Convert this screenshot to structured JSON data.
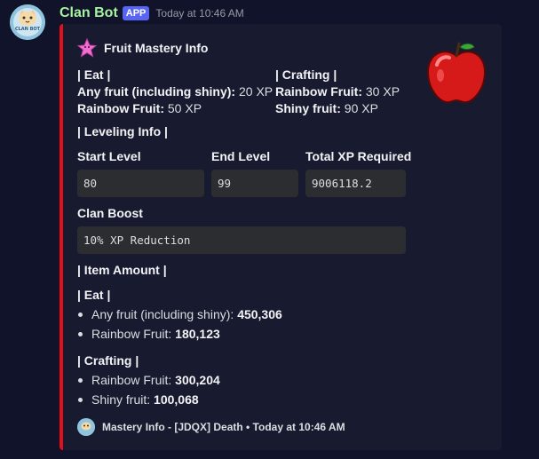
{
  "message": {
    "username": "Clan Bot",
    "badge": "APP",
    "timestamp": "Today at 10:46 AM",
    "avatar_text": "CLAN BOT"
  },
  "embed": {
    "accent_color": "#e1101a",
    "author": "Fruit Mastery Info",
    "thumbnail": "red-apple-icon",
    "eat": {
      "title": "| Eat |",
      "lines": [
        {
          "label": "Any fruit (including shiny):",
          "value": "20 XP"
        },
        {
          "label": "Rainbow Fruit:",
          "value": "50 XP"
        }
      ]
    },
    "crafting": {
      "title": "| Crafting |",
      "lines": [
        {
          "label": "Rainbow Fruit:",
          "value": "30 XP"
        },
        {
          "label": "Shiny fruit:",
          "value": "90 XP"
        }
      ]
    },
    "leveling_title": "| Leveling Info |",
    "start_level": {
      "label": "Start Level",
      "value": "80"
    },
    "end_level": {
      "label": "End Level",
      "value": "99"
    },
    "total_xp": {
      "label": "Total XP Required",
      "value": "9006118.2"
    },
    "clan_boost": {
      "label": "Clan Boost",
      "value": "10% XP Reduction"
    },
    "item_amount_title": "| Item Amount |",
    "items_eat": {
      "title": "| Eat |",
      "items": [
        {
          "label": "Any fruit (including shiny):",
          "value": "450,306"
        },
        {
          "label": "Rainbow Fruit:",
          "value": "180,123"
        }
      ]
    },
    "items_crafting": {
      "title": "| Crafting |",
      "items": [
        {
          "label": "Rainbow Fruit:",
          "value": "300,204"
        },
        {
          "label": "Shiny fruit:",
          "value": "100,068"
        }
      ]
    },
    "footer": "Mastery Info - [JDQX] Death • Today at 10:46 AM"
  }
}
